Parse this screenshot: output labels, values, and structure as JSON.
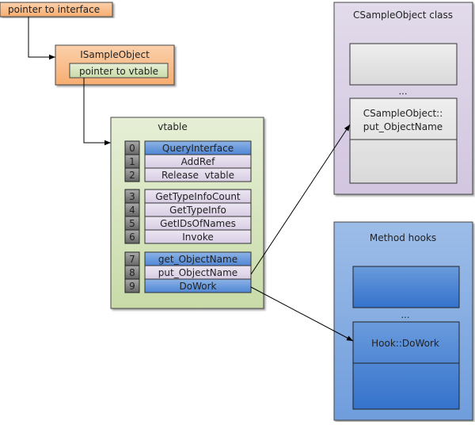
{
  "pointer_to_interface": {
    "label": "pointer to interface",
    "color": "#f9c08f"
  },
  "isampleobject": {
    "title": "ISampleObject",
    "pointer_to_vtable": "pointer to vtable",
    "color": "#f9c08f",
    "inner_color": "#d4e6b8"
  },
  "vtable": {
    "title": "vtable",
    "color": "#d6e4bd",
    "groups": [
      [
        {
          "index": "0",
          "name": "QueryInterface",
          "highlight": true
        },
        {
          "index": "1",
          "name": "AddRef",
          "highlight": false
        },
        {
          "index": "2",
          "name": "Release  vtable",
          "highlight": false
        }
      ],
      [
        {
          "index": "3",
          "name": "GetTypeInfoCount",
          "highlight": false
        },
        {
          "index": "4",
          "name": "GetTypeInfo",
          "highlight": false
        },
        {
          "index": "5",
          "name": "GetIDsOfNames",
          "highlight": false
        },
        {
          "index": "6",
          "name": "Invoke",
          "highlight": false
        }
      ],
      [
        {
          "index": "7",
          "name": "get_ObjectName",
          "highlight": true
        },
        {
          "index": "8",
          "name": "put_ObjectName",
          "highlight": false
        },
        {
          "index": "9",
          "name": "DoWork",
          "highlight": true
        }
      ]
    ]
  },
  "csampleobject_class": {
    "title": "CSampleObject class",
    "ellipsis": "...",
    "method_line1": "CSampleObject::",
    "method_line2": "put_ObjectName",
    "color": "#dcd3e6"
  },
  "method_hooks": {
    "title": "Method hooks",
    "ellipsis": "...",
    "method": "Hook::DoWork",
    "color": "#8fb3e3"
  }
}
